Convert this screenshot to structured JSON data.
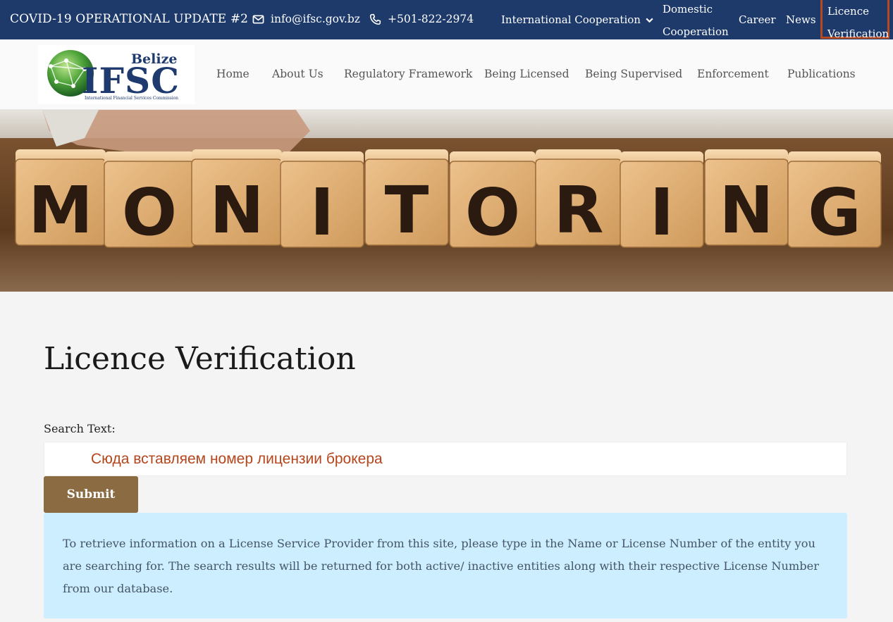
{
  "topbar": {
    "alert": "COVID-19 OPERATIONAL UPDATE #2",
    "email": "info@ifsc.gov.bz",
    "phone": "+501-822-2974",
    "nav": {
      "international": "International Cooperation",
      "domestic_line1": "Domestic",
      "domestic_line2": "Cooperation",
      "career": "Career",
      "news": "News",
      "licence_line1": "Licence",
      "licence_line2": "Verification"
    }
  },
  "logo": {
    "country": "Belize",
    "acronym": "IFSC",
    "full_name": "International Financial Services Commission"
  },
  "main_nav": [
    "Home",
    "About Us",
    "Regulatory Framework",
    "Being Licensed",
    "Being Supervised",
    "Enforcement",
    "Publications"
  ],
  "banner": {
    "letters": [
      "M",
      "O",
      "N",
      "I",
      "T",
      "O",
      "R",
      "I",
      "N",
      "G"
    ]
  },
  "page": {
    "title": "Licence Verification",
    "search_label": "Search Text:",
    "search_placeholder": "Сюда вставляем номер лицензии брокера",
    "submit_label": "Submit",
    "info_text": "To retrieve information on a License Service Provider from this site, please type in the Name or License Number of the entity you are searching for. The search results will be returned for both active/ inactive entities along with their respective License Number from our database."
  },
  "colors": {
    "topbar_bg": "#1d3a6b",
    "highlight_border": "#b8481d",
    "submit_bg": "#8b6b42",
    "info_bg": "#cceeff",
    "input_text": "#b5451b"
  }
}
